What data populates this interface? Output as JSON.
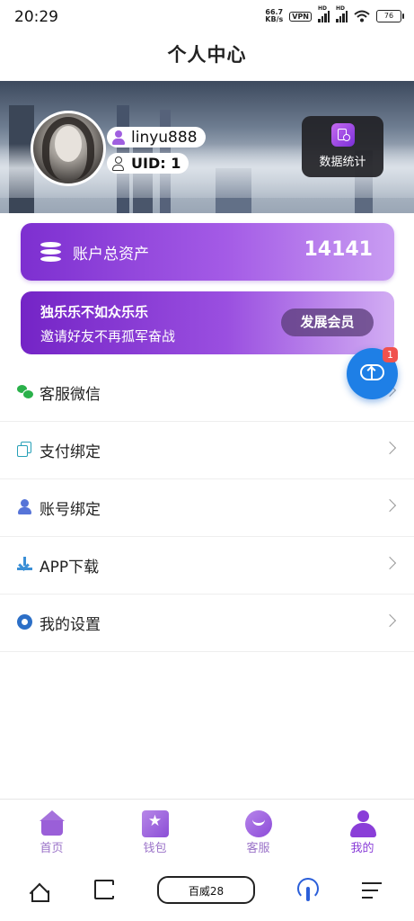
{
  "status_bar": {
    "time": "20:29",
    "net_speed": "66.7",
    "net_unit": "KB/s",
    "vpn": "VPN",
    "hd": "HD",
    "battery": "76"
  },
  "header": {
    "title": "个人中心"
  },
  "profile": {
    "username": "linyu888",
    "uid_text": "UID: 1",
    "stats_label": "数据统计"
  },
  "assets": {
    "label": "账户总资产",
    "amount": "14141"
  },
  "invite": {
    "title": "独乐乐不如众乐乐",
    "subtitle": "邀请好友不再孤军奋战",
    "button": "发展会员"
  },
  "menu": [
    {
      "label": "客服微信",
      "icon": "wechat-icon"
    },
    {
      "label": "支付绑定",
      "icon": "copy-icon"
    },
    {
      "label": "账号绑定",
      "icon": "user-icon"
    },
    {
      "label": "APP下载",
      "icon": "download-icon"
    },
    {
      "label": "我的设置",
      "icon": "gear-icon"
    }
  ],
  "fab": {
    "badge": "1",
    "icon": "cloud-upload-icon"
  },
  "tabs": [
    {
      "label": "首页",
      "icon": "home-icon"
    },
    {
      "label": "钱包",
      "icon": "wallet-icon"
    },
    {
      "label": "客服",
      "icon": "smile-icon"
    },
    {
      "label": "我的",
      "icon": "user-icon",
      "active": true
    }
  ],
  "system_nav": {
    "center_label": "百威28"
  },
  "colors": {
    "accent": "#8a3ed8",
    "fab": "#1e7fe6",
    "badge": "#f0524e"
  }
}
